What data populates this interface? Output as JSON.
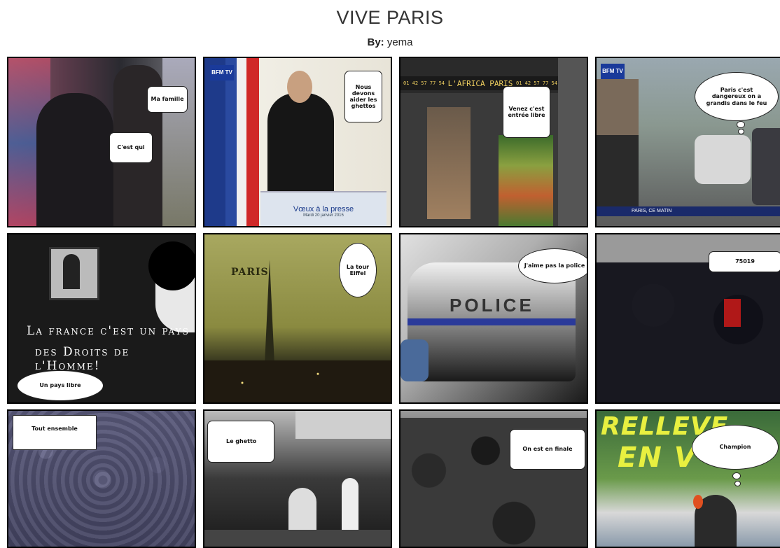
{
  "header": {
    "title": "VIVE PARIS",
    "by_label": "By:",
    "author": "yema"
  },
  "panels": [
    {
      "bubble": "Ma famille",
      "bubble2": "C'est qui"
    },
    {
      "bubble": "Nous devons aider les ghettos",
      "sign": "Vœux à la presse",
      "sign_sub": "Mardi 20 janvier 2015",
      "logo": "BFM TV"
    },
    {
      "bubble": "Venez c'est entrée libre",
      "shop_sign": "L'AFRICA PARIS",
      "phone1": "01 42 57 77 54",
      "phone2": "01 42 57 77 54"
    },
    {
      "bubble": "Paris c'est dangereux on a grandis dans le feu",
      "logo": "BFM TV",
      "caption": "PARIS, CE MATIN"
    },
    {
      "overlay_line1": "La france c'est un pays",
      "overlay_line2": "des Droits de l'Homme!",
      "bubble": "Un pays libre"
    },
    {
      "bubble": "La tour Eiffel",
      "label": "PARIS"
    },
    {
      "bubble": "J'aime pas la police",
      "car_text": "POLICE"
    },
    {
      "bubble": "75019"
    },
    {
      "bubble": "Tout ensemble"
    },
    {
      "bubble": "Le ghetto"
    },
    {
      "bubble": "On est en finale"
    },
    {
      "bubble": "Champion",
      "wall_text_1": "RELLEVE",
      "wall_text_2": "EN V"
    }
  ]
}
